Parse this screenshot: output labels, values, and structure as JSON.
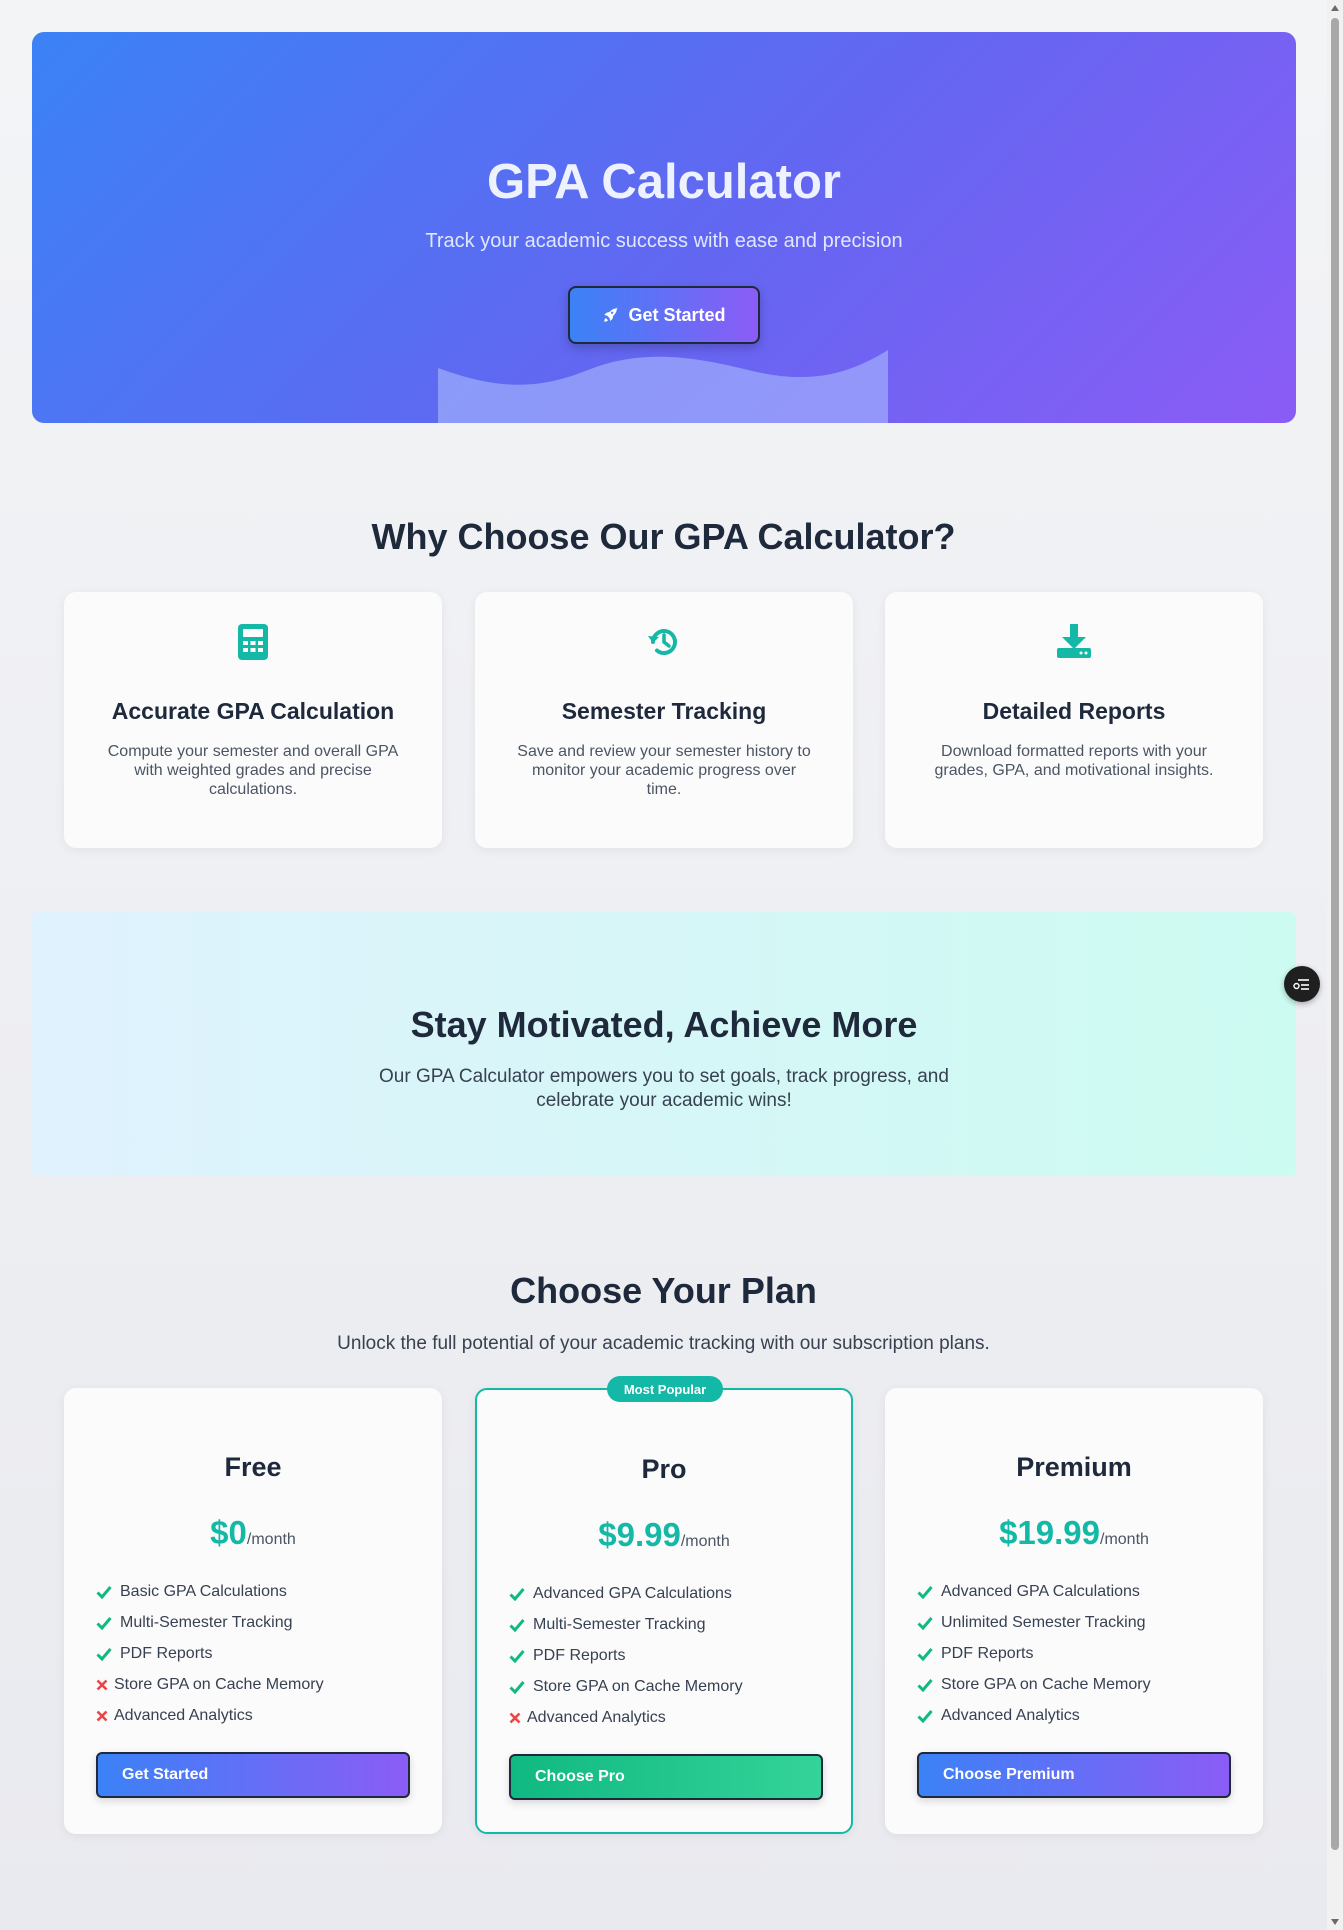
{
  "hero": {
    "title": "GPA Calculator",
    "subtitle": "Track your academic success with ease and precision",
    "cta_label": "Get Started",
    "cta_icon": "rocket-icon"
  },
  "features": {
    "title": "Why Choose Our GPA Calculator?",
    "items": [
      {
        "icon": "calculator-icon",
        "title": "Accurate GPA Calculation",
        "desc": "Compute your semester and overall GPA with weighted grades and precise calculations."
      },
      {
        "icon": "history-icon",
        "title": "Semester Tracking",
        "desc": "Save and review your semester history to monitor your academic progress over time."
      },
      {
        "icon": "download-icon",
        "title": "Detailed Reports",
        "desc": "Download formatted reports with your grades, GPA, and motivational insights."
      }
    ]
  },
  "motivation": {
    "title": "Stay Motivated, Achieve More",
    "text": "Our GPA Calculator empowers you to set goals, track progress, and celebrate your academic wins!"
  },
  "plans": {
    "title": "Choose Your Plan",
    "subtitle": "Unlock the full potential of your academic tracking with our subscription plans.",
    "items": [
      {
        "name": "Free",
        "price": "$0",
        "period": "/month",
        "button": "Get Started",
        "features": [
          {
            "text": "Basic GPA Calculations",
            "included": true
          },
          {
            "text": "Multi-Semester Tracking",
            "included": true
          },
          {
            "text": "PDF Reports",
            "included": true
          },
          {
            "text": "Store GPA on Cache Memory",
            "included": false
          },
          {
            "text": "Advanced Analytics",
            "included": false
          }
        ]
      },
      {
        "name": "Pro",
        "price": "$9.99",
        "period": "/month",
        "button": "Choose Pro",
        "badge": "Most Popular",
        "features": [
          {
            "text": "Advanced GPA Calculations",
            "included": true
          },
          {
            "text": "Multi-Semester Tracking",
            "included": true
          },
          {
            "text": "PDF Reports",
            "included": true
          },
          {
            "text": "Store GPA on Cache Memory",
            "included": true
          },
          {
            "text": "Advanced Analytics",
            "included": false
          }
        ]
      },
      {
        "name": "Premium",
        "price": "$19.99",
        "period": "/month",
        "button": "Choose Premium",
        "features": [
          {
            "text": "Advanced GPA Calculations",
            "included": true
          },
          {
            "text": "Unlimited Semester Tracking",
            "included": true
          },
          {
            "text": "PDF Reports",
            "included": true
          },
          {
            "text": "Store GPA on Cache Memory",
            "included": true
          },
          {
            "text": "Advanced Analytics",
            "included": true
          }
        ]
      }
    ]
  },
  "colors": {
    "accent": "#14b8a6",
    "check": "#10b981",
    "cross": "#ef4444",
    "gradient_start": "#3b82f6",
    "gradient_end": "#8b5cf6"
  },
  "floating_button_icon": "toggle-list-icon"
}
